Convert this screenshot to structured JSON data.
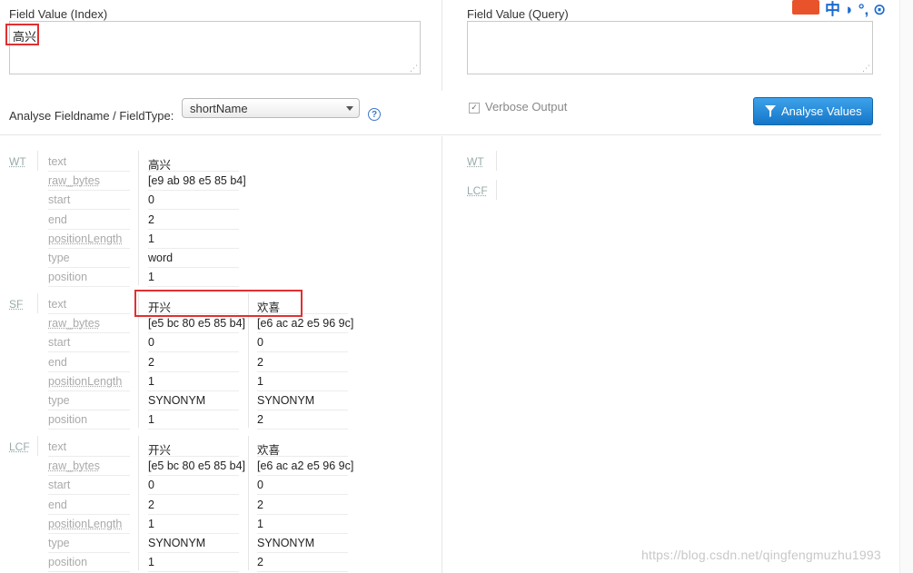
{
  "index_field": {
    "label": "Field Value (Index)",
    "value": "高兴"
  },
  "query_field": {
    "label": "Field Value (Query)",
    "value": ""
  },
  "fieldtype": {
    "label": "Analyse Fieldname / FieldType:",
    "selected": "shortName"
  },
  "help_icon": "?",
  "verbose": {
    "label": "Verbose Output"
  },
  "analyse_button": {
    "label": "Analyse Values"
  },
  "index_analysis": {
    "WT": {
      "abbr": "WT",
      "rows": [
        {
          "attr": "text",
          "vals": [
            "高兴"
          ]
        },
        {
          "attr": "raw_bytes",
          "vals": [
            "[e9 ab 98 e5 85 b4]"
          ]
        },
        {
          "attr": "start",
          "vals": [
            "0"
          ]
        },
        {
          "attr": "end",
          "vals": [
            "2"
          ]
        },
        {
          "attr": "positionLength",
          "vals": [
            "1"
          ]
        },
        {
          "attr": "type",
          "vals": [
            "word"
          ]
        },
        {
          "attr": "position",
          "vals": [
            "1"
          ]
        }
      ]
    },
    "SF": {
      "abbr": "SF",
      "rows": [
        {
          "attr": "text",
          "vals": [
            "开兴",
            "欢喜"
          ]
        },
        {
          "attr": "raw_bytes",
          "vals": [
            "[e5 bc 80 e5 85 b4]",
            "[e6 ac a2 e5 96 9c]"
          ]
        },
        {
          "attr": "start",
          "vals": [
            "0",
            "0"
          ]
        },
        {
          "attr": "end",
          "vals": [
            "2",
            "2"
          ]
        },
        {
          "attr": "positionLength",
          "vals": [
            "1",
            "1"
          ]
        },
        {
          "attr": "type",
          "vals": [
            "SYNONYM",
            "SYNONYM"
          ]
        },
        {
          "attr": "position",
          "vals": [
            "1",
            "2"
          ]
        }
      ]
    },
    "LCF": {
      "abbr": "LCF",
      "rows": [
        {
          "attr": "text",
          "vals": [
            "开兴",
            "欢喜"
          ]
        },
        {
          "attr": "raw_bytes",
          "vals": [
            "[e5 bc 80 e5 85 b4]",
            "[e6 ac a2 e5 96 9c]"
          ]
        },
        {
          "attr": "start",
          "vals": [
            "0",
            "0"
          ]
        },
        {
          "attr": "end",
          "vals": [
            "2",
            "2"
          ]
        },
        {
          "attr": "positionLength",
          "vals": [
            "1",
            "1"
          ]
        },
        {
          "attr": "type",
          "vals": [
            "SYNONYM",
            "SYNONYM"
          ]
        },
        {
          "attr": "position",
          "vals": [
            "1",
            "2"
          ]
        }
      ]
    }
  },
  "query_analysis": {
    "WT": "WT",
    "LCF": "LCF"
  },
  "topright_glyphs": "中 ◗ °, ⊙",
  "watermark": "https://blog.csdn.net/qingfengmuzhu1993"
}
